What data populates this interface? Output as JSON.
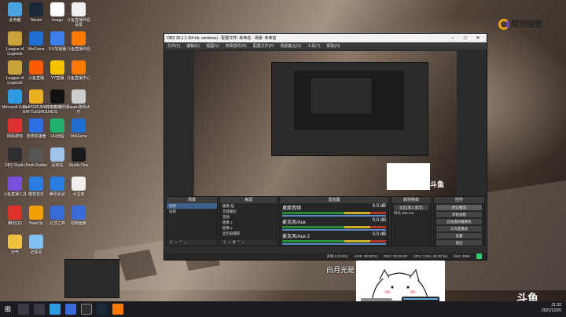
{
  "desktop": {
    "icons": [
      {
        "label": "此电脑",
        "color": "#4aa3df"
      },
      {
        "label": "Steam",
        "color": "#1b2838"
      },
      {
        "label": "bongo",
        "color": "#ffffff"
      },
      {
        "label": "斗鱼直播伴侣设置",
        "color": "#f0f0f0"
      },
      {
        "label": "League of Legends",
        "color": "#c9a23a"
      },
      {
        "label": "WeGame",
        "color": "#1f6fd1"
      },
      {
        "label": "UU加速器",
        "color": "#3d7eea"
      },
      {
        "label": "斗鱼直播伴侣",
        "color": "#ff7a00"
      },
      {
        "label": "League of Legends",
        "color": "#c9a23a"
      },
      {
        "label": "斗鱼直播",
        "color": "#ff5a00"
      },
      {
        "label": "YY直播",
        "color": "#f4c400"
      },
      {
        "label": "斗鱼直播中心",
        "color": "#ff7a00"
      },
      {
        "label": "Microsoft Edge",
        "color": "#2f9be0"
      },
      {
        "label": "PLAYERUNKNOWN'S BATTLEGROUNDS",
        "color": "#e8b020"
      },
      {
        "label": "抖音直播伴侣",
        "color": "#111111"
      },
      {
        "label": "Steam游戏大厅",
        "color": "#cccccc"
      },
      {
        "label": "网易游戏",
        "color": "#e03030"
      },
      {
        "label": "雷神加速器",
        "color": "#2c6fe0"
      },
      {
        "label": "UU远程",
        "color": "#20b070"
      },
      {
        "label": "WeGame",
        "color": "#1f6fd1"
      },
      {
        "label": "OBS Studio",
        "color": "#302e31"
      },
      {
        "label": "Tomb Raider",
        "color": "#555555"
      },
      {
        "label": "回收站",
        "color": "#a0c4e8"
      },
      {
        "label": "Studio One",
        "color": "#1a1a1a"
      },
      {
        "label": "斗鱼直播工具",
        "color": "#7a4fe0"
      },
      {
        "label": "酷狗音乐",
        "color": "#2a7de1"
      },
      {
        "label": "腾讯会议",
        "color": "#2a7de1"
      },
      {
        "label": "大宝库",
        "color": "#f0f0f0"
      },
      {
        "label": "腾讯QQ",
        "color": "#e0302a"
      },
      {
        "label": "BreeZip",
        "color": "#f0a000"
      },
      {
        "label": "云顶之弈",
        "color": "#3a6ad8"
      },
      {
        "label": "控制面板",
        "color": "#3a6ad8"
      },
      {
        "label": "天气",
        "color": "#f0c040"
      },
      {
        "label": "记事本",
        "color": "#7fc0f0"
      }
    ]
  },
  "obs": {
    "title": "OBS 26.1.1 (64-bit, windows) - 配置文件: 未命名 - 场景: 未命名",
    "menu": [
      "文件(F)",
      "编辑(E)",
      "视图(V)",
      "停靠部件(D)",
      "配置文件(P)",
      "场景集合(S)",
      "工具(T)",
      "帮助(H)"
    ],
    "scenes_panel": {
      "title": "场景",
      "items": [
        "场景",
        "场景"
      ],
      "selected": 0
    },
    "sources_panel": {
      "title": "来源",
      "items": [
        "图像 猫",
        "音频输出",
        "音频",
        "图像 1",
        "图像 2",
        "显示器捕获"
      ]
    },
    "mixer_panel": {
      "title": "混音器",
      "channels": [
        "桌面音频",
        "麦克风/Aux",
        "麦克风/Aux 2"
      ],
      "values": [
        "0.0 dB",
        "0.0 dB",
        "0.0 dB"
      ]
    },
    "transitions_panel": {
      "title": "转场特效",
      "fade": "淡出(渐入渐出)",
      "duration_label": "时长",
      "duration": "300 ms"
    },
    "controls_panel": {
      "title": "控件",
      "buttons": [
        "停止推流",
        "开始录制",
        "启动虚拟摄像机",
        "工作室模式",
        "设置",
        "退出"
      ]
    },
    "status": {
      "live": "LIVE: 00:00:51",
      "rec": "REC: 00:00:00",
      "cpu": "CPU: 3.4%, 30.00 fps",
      "drop": "丢帧 0 (0.0%)",
      "kb": "kb/s: 3990"
    }
  },
  "overlay": {
    "subtitle": "白月光是",
    "watermark_text": "知识版图",
    "douyu_text": "斗鱼"
  },
  "taskbar": {
    "time": "21:32",
    "date": "2021/12/20"
  },
  "colors": {
    "accent": "#3d5f8a",
    "live": "#2ecc71"
  }
}
